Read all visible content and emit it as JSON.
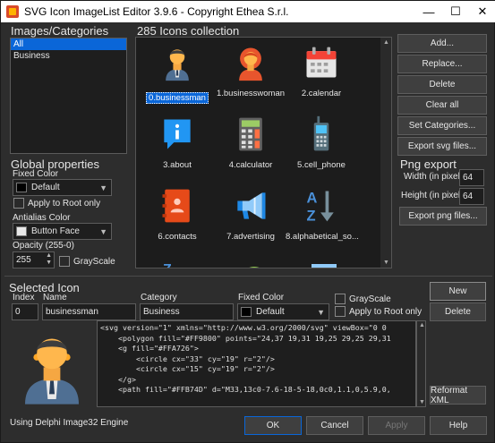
{
  "window": {
    "title": "SVG Icon ImageList Editor 3.9.6 - Copyright Ethea S.r.l.",
    "min": "—",
    "max": "☐",
    "close": "✕"
  },
  "categories": {
    "label": "Images/Categories",
    "items": [
      "All",
      "Business"
    ],
    "selected": 0
  },
  "collection": {
    "label": "285 Icons collection"
  },
  "icons": [
    {
      "caption": "0.businessman",
      "icon": "businessman-icon",
      "selected": true
    },
    {
      "caption": "1.businesswoman",
      "icon": "businesswoman-icon"
    },
    {
      "caption": "2.calendar",
      "icon": "calendar-icon"
    },
    {
      "caption": "3.about",
      "icon": "about-icon"
    },
    {
      "caption": "4.calculator",
      "icon": "calculator-icon"
    },
    {
      "caption": "5.cell_phone",
      "icon": "cell-phone-icon"
    },
    {
      "caption": "6.contacts",
      "icon": "contacts-icon"
    },
    {
      "caption": "7.advertising",
      "icon": "advertising-icon"
    },
    {
      "caption": "8.alphabetical_so...",
      "icon": "alphabetical-sort-icon"
    }
  ],
  "right_buttons": {
    "add": "Add...",
    "replace": "Replace...",
    "delete": "Delete",
    "clear_all": "Clear all",
    "set_categories": "Set Categories...",
    "export_svg": "Export svg files..."
  },
  "png_export": {
    "label": "Png export",
    "width_label": "Width (in pixel)",
    "width": "64",
    "height_label": "Height (in pixel)",
    "height": "64",
    "export_png": "Export png files..."
  },
  "global": {
    "label": "Global properties",
    "fixed_color_label": "Fixed Color",
    "fixed_color": "Default",
    "apply_root": "Apply to Root only",
    "antialias_label": "Antialias Color",
    "antialias": "Button Face",
    "opacity_label": "Opacity (255-0)",
    "opacity": "255",
    "grayscale": "GrayScale"
  },
  "selected": {
    "label": "Selected Icon",
    "index_label": "Index",
    "index": "0",
    "name_label": "Name",
    "name": "businessman",
    "category_label": "Category",
    "category": "Business",
    "fixed_color_label": "Fixed Color",
    "fixed_color": "Default",
    "grayscale": "GrayScale",
    "apply_root": "Apply to Root only",
    "new": "New",
    "delete": "Delete",
    "reformat": "Reformat XML"
  },
  "svg_code": [
    "<svg version=\"1\" xmlns=\"http://www.w3.org/2000/svg\" viewBox=\"0 0",
    "    <polygon fill=\"#FF9800\" points=\"24,37 19,31 19,25 29,25 29,31",
    "    <g fill=\"#FFA726\">",
    "        <circle cx=\"33\" cy=\"19\" r=\"2\"/>",
    "        <circle cx=\"15\" cy=\"19\" r=\"2\"/>",
    "    </g>",
    "    <path fill=\"#FFB74D\" d=\"M33,13c0-7.6-18-5-18,0c0,1.1,0,5.9,0,"
  ],
  "footer": {
    "status": "Using Delphi Image32 Engine",
    "ok": "OK",
    "cancel": "Cancel",
    "apply": "Apply",
    "help": "Help"
  },
  "colors": {
    "accent": "#0a66d8",
    "bg": "#2d2d2d",
    "panel": "#1c1c1c"
  }
}
